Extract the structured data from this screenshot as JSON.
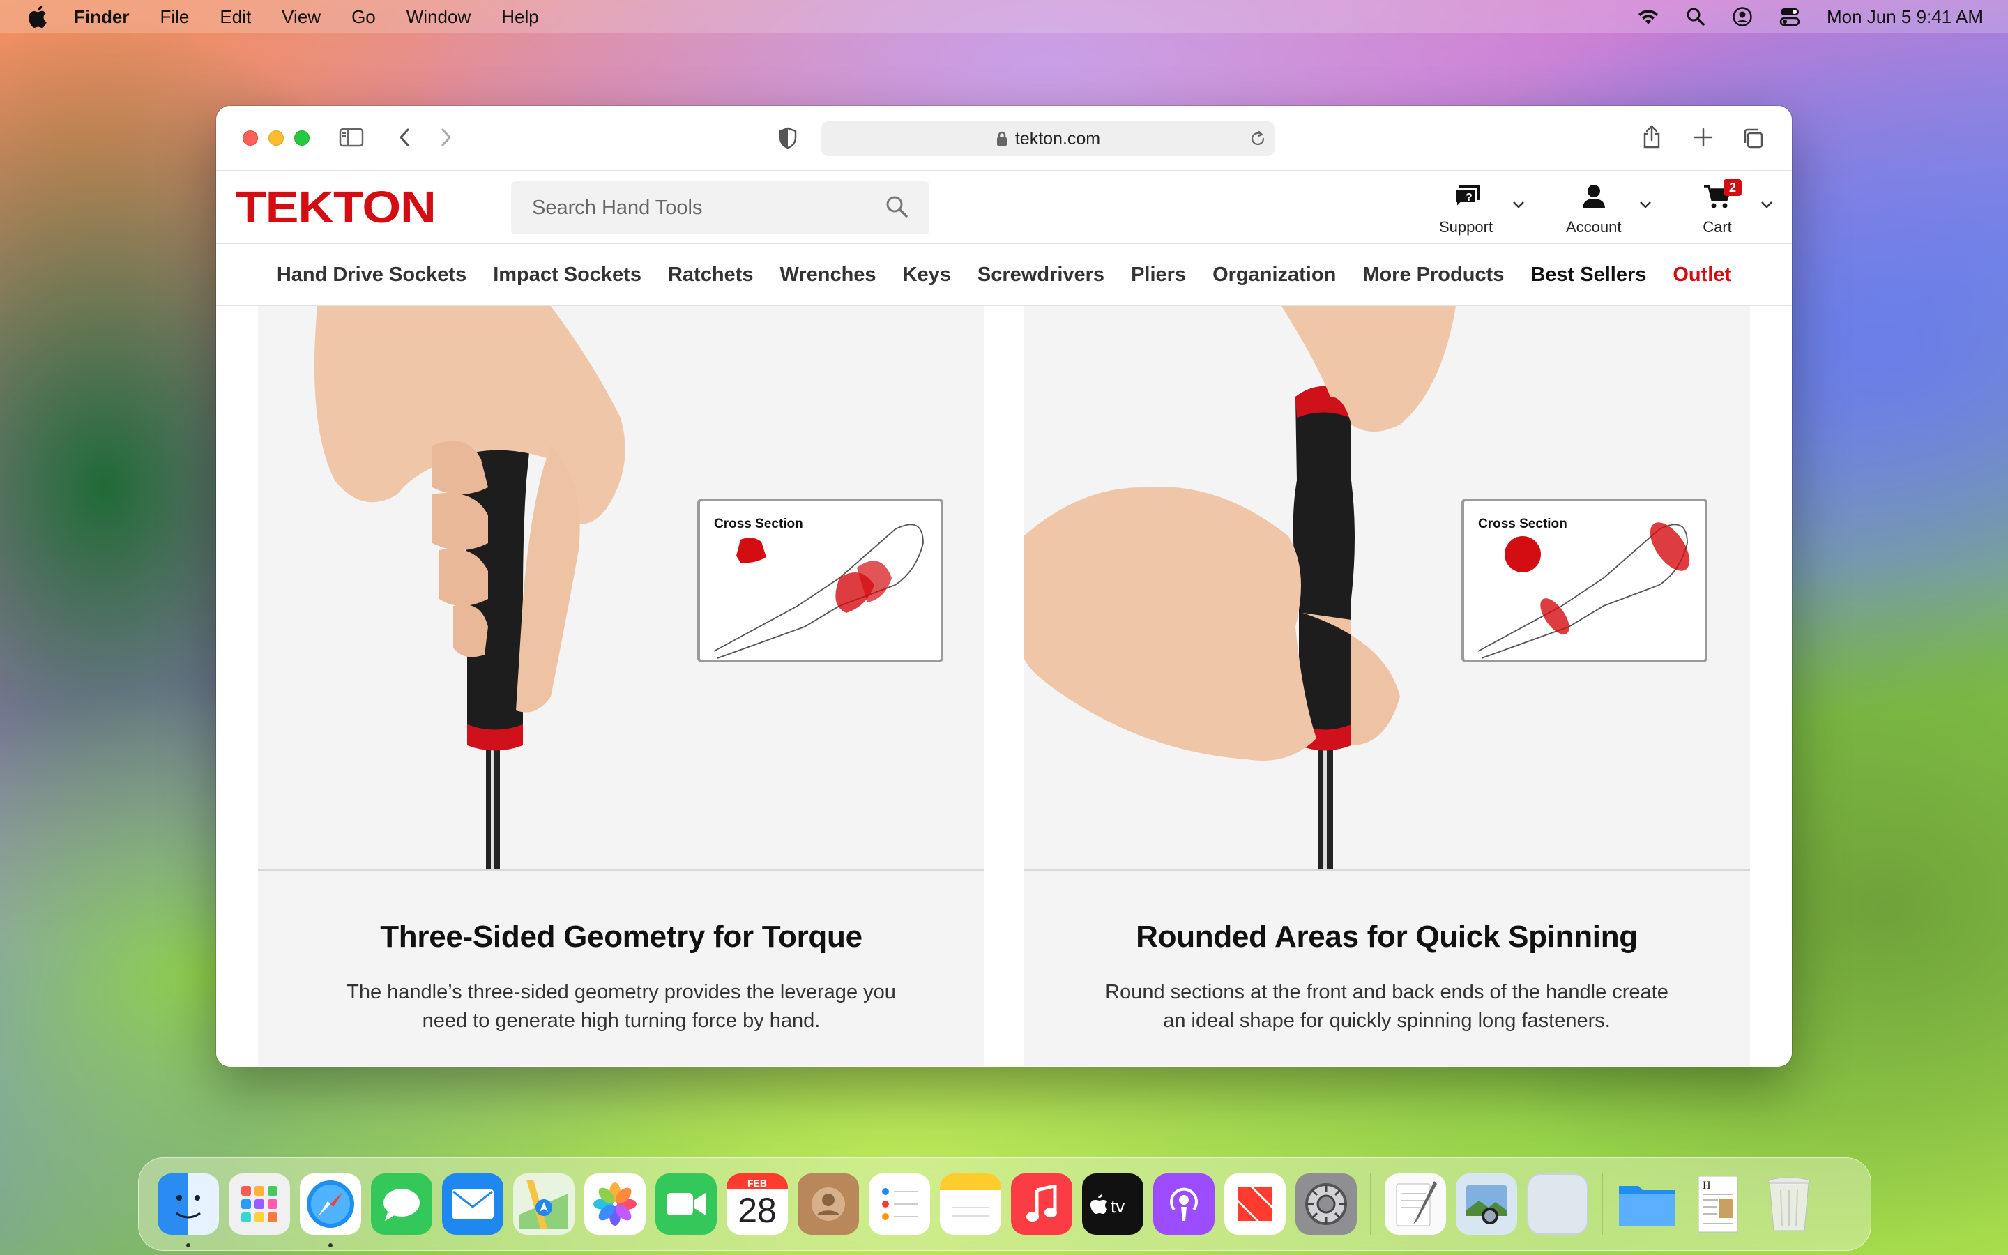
{
  "menubar": {
    "app_name": "Finder",
    "menus": [
      "File",
      "Edit",
      "View",
      "Go",
      "Window",
      "Help"
    ],
    "datetime": "Mon Jun 5  9:41 AM"
  },
  "browser": {
    "url": "tekton.com"
  },
  "site": {
    "logo": "TEKTON",
    "search_placeholder": "Search Hand Tools",
    "support_label": "Support",
    "account_label": "Account",
    "cart_label": "Cart",
    "cart_count": "2",
    "nav": [
      "Hand Drive Sockets",
      "Impact Sockets",
      "Ratchets",
      "Wrenches",
      "Keys",
      "Screwdrivers",
      "Pliers",
      "Organization",
      "More Products",
      "Best Sellers",
      "Outlet"
    ],
    "colors": {
      "brand_red": "#d40d12"
    }
  },
  "features": [
    {
      "cross_section_label": "Cross Section",
      "title": "Three-Sided Geometry for Torque",
      "body": "The handle’s three-sided geometry provides the leverage you need to generate high turning force by hand."
    },
    {
      "cross_section_label": "Cross Section",
      "title": "Rounded Areas for Quick Spinning",
      "body": "Round sections at the front and back ends of the handle create an ideal shape for quickly spinning long fasteners."
    }
  ],
  "dock": {
    "apps": [
      "Finder",
      "Launchpad",
      "Safari",
      "Messages",
      "Mail",
      "Maps",
      "Photos",
      "FaceTime",
      "Calendar",
      "Contacts",
      "Reminders",
      "Notes",
      "Music",
      "TV",
      "Podcasts",
      "News",
      "System Settings",
      "TextEdit",
      "Preview",
      "Blank",
      "Folder",
      "Document",
      "Trash"
    ],
    "calendar_month": "FEB",
    "calendar_day": "28"
  }
}
